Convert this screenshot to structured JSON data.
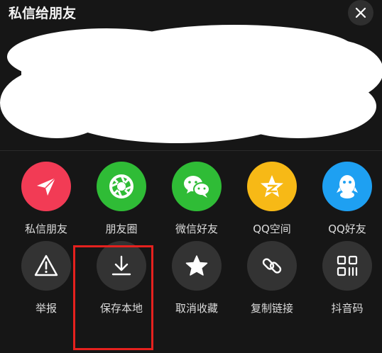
{
  "header": {
    "title": "私信给朋友"
  },
  "share_row": [
    {
      "label": "私信朋友",
      "icon": "paper-plane-icon",
      "color": "#f23b55"
    },
    {
      "label": "朋友圈",
      "icon": "wechat-moments-icon",
      "color": "#2fbc36"
    },
    {
      "label": "微信好友",
      "icon": "wechat-icon",
      "color": "#2fbc36"
    },
    {
      "label": "QQ空间",
      "icon": "qzone-star-icon",
      "color": "#f7b916"
    },
    {
      "label": "QQ好友",
      "icon": "qq-penguin-icon",
      "color": "#1ea0f2"
    }
  ],
  "action_row": [
    {
      "label": "举报",
      "icon": "warning-icon"
    },
    {
      "label": "保存本地",
      "icon": "download-icon"
    },
    {
      "label": "取消收藏",
      "icon": "star-icon"
    },
    {
      "label": "复制链接",
      "icon": "link-icon"
    },
    {
      "label": "抖音码",
      "icon": "qr-code-icon"
    }
  ],
  "colors": {
    "background": "#161616",
    "action_circle": "#333333",
    "highlight": "#e5211e"
  }
}
